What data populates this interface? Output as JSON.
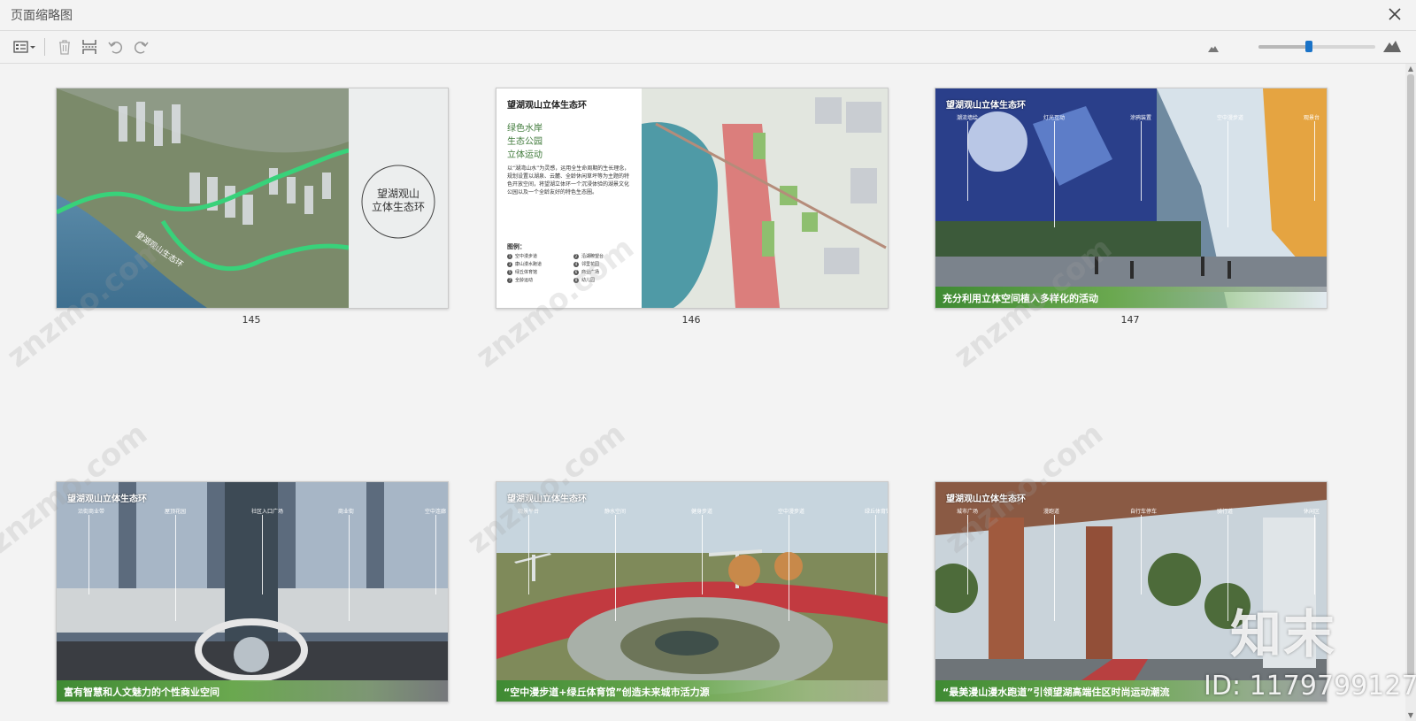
{
  "window": {
    "title": "页面缩略图"
  },
  "toolbar": {
    "zoom_level": 0.43,
    "icons": [
      "thumbnail-options-icon",
      "delete-page-icon",
      "insert-page-icon",
      "undo-icon",
      "redo-icon",
      "zoom-out-mountain-icon",
      "zoom-in-mountain-icon"
    ]
  },
  "thumbnails": [
    {
      "page": "145",
      "circle_title_line1": "望湖观山",
      "circle_title_line2": "立体生态环",
      "route_label": "望湖观山生态环"
    },
    {
      "page": "146",
      "heading": "望湖观山立体生态环",
      "subtitle_1": "绿色水岸",
      "subtitle_2": "生态公园",
      "subtitle_3": "立体运动",
      "body": "以“湖湾山水”为灵感，运用全生命周期的生长理念，规划设置以湖泉、云麓、全龄休闲草坪等为主题的特色开放空间，将望湖立体环一个沉浸体验的湖景文化公园以及一个全龄友好的特色生态圈。",
      "legend_title": "图例：",
      "legend": [
        "空中漫步道",
        "沿湖瞭望台",
        "康山漫水跑道",
        "邻里花园",
        "绿丘体育馆",
        "商业广场",
        "全龄运动",
        "幼儿园"
      ]
    },
    {
      "page": "147",
      "heading": "望湖观山立体生态环",
      "caption": "充分利用立体空间植入多样化的活动",
      "callouts": [
        "潮流墙绘",
        "灯光互动",
        "涂鸦装置",
        "空中漫步道",
        "观景台"
      ]
    },
    {
      "page": "",
      "heading": "望湖观山立体生态环",
      "caption": "富有智慧和人文魅力的个性商业空间",
      "callouts": [
        "沿街商业带",
        "屋顶花园",
        "社区入口广场",
        "商业街",
        "空中连廊"
      ]
    },
    {
      "page": "",
      "heading": "望湖观山立体生态环",
      "caption": "“空中漫步道+绿丘体育馆”创造未来城市活力源",
      "callouts": [
        "观景平台",
        "静水空间",
        "健身步道",
        "空中漫步道",
        "绿丘体育馆"
      ]
    },
    {
      "page": "",
      "heading": "望湖观山立体生态环",
      "caption": "“最美漫山漫水跑道”引领望湖高端住区时尚运动潮流",
      "callouts": [
        "城市广场",
        "漫跑道",
        "自行车停车",
        "骑行道",
        "休闲区"
      ]
    }
  ],
  "watermark": {
    "text": "znzmo.com",
    "logo": "知末",
    "id": "ID: 1179799127"
  }
}
